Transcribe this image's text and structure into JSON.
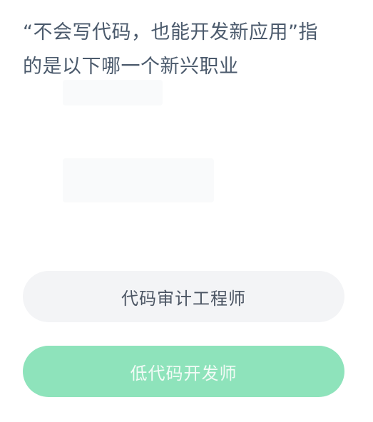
{
  "question": {
    "line1": "“不会写代码，也能开发新应用”指",
    "line2": "的是以下哪一个新兴职业"
  },
  "options": [
    {
      "label": "代码审计工程师",
      "selected": false
    },
    {
      "label": "低代码开发师",
      "selected": true
    }
  ],
  "colors": {
    "question_text": "#4b5a6c",
    "option_bg": "#f3f4f6",
    "option_text": "#4b5563",
    "selected_bg": "#8ee3bb",
    "selected_text": "#f2fbf6"
  }
}
